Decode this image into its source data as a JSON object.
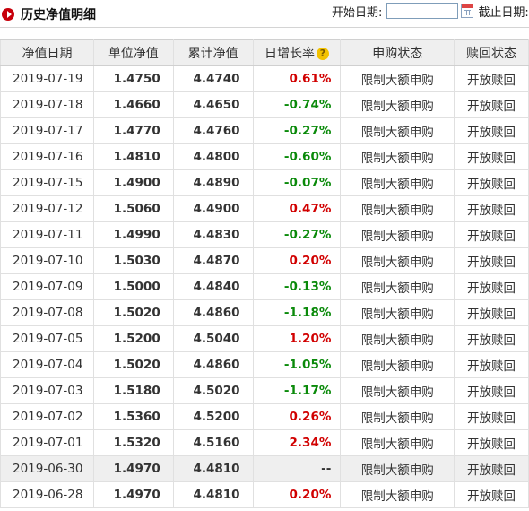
{
  "header": {
    "title": "历史净值明细",
    "start_label": "开始日期:",
    "start_value": "",
    "end_label": "截止日期:"
  },
  "colors": {
    "up": "#d10000",
    "down": "#0a8a0a",
    "brand": "#c7000b"
  },
  "columns": [
    "净值日期",
    "单位净值",
    "累计净值",
    "日增长率",
    "申购状态",
    "赎回状态"
  ],
  "help_icon": "?",
  "rows": [
    {
      "date": "2019-07-19",
      "unit": "1.4750",
      "acc": "4.4740",
      "chg": "0.61%",
      "dir": "up",
      "buy": "限制大额申购",
      "redeem": "开放赎回"
    },
    {
      "date": "2019-07-18",
      "unit": "1.4660",
      "acc": "4.4650",
      "chg": "-0.74%",
      "dir": "down",
      "buy": "限制大额申购",
      "redeem": "开放赎回"
    },
    {
      "date": "2019-07-17",
      "unit": "1.4770",
      "acc": "4.4760",
      "chg": "-0.27%",
      "dir": "down",
      "buy": "限制大额申购",
      "redeem": "开放赎回"
    },
    {
      "date": "2019-07-16",
      "unit": "1.4810",
      "acc": "4.4800",
      "chg": "-0.60%",
      "dir": "down",
      "buy": "限制大额申购",
      "redeem": "开放赎回"
    },
    {
      "date": "2019-07-15",
      "unit": "1.4900",
      "acc": "4.4890",
      "chg": "-0.07%",
      "dir": "down",
      "buy": "限制大额申购",
      "redeem": "开放赎回"
    },
    {
      "date": "2019-07-12",
      "unit": "1.5060",
      "acc": "4.4900",
      "chg": "0.47%",
      "dir": "up",
      "buy": "限制大额申购",
      "redeem": "开放赎回"
    },
    {
      "date": "2019-07-11",
      "unit": "1.4990",
      "acc": "4.4830",
      "chg": "-0.27%",
      "dir": "down",
      "buy": "限制大额申购",
      "redeem": "开放赎回"
    },
    {
      "date": "2019-07-10",
      "unit": "1.5030",
      "acc": "4.4870",
      "chg": "0.20%",
      "dir": "up",
      "buy": "限制大额申购",
      "redeem": "开放赎回"
    },
    {
      "date": "2019-07-09",
      "unit": "1.5000",
      "acc": "4.4840",
      "chg": "-0.13%",
      "dir": "down",
      "buy": "限制大额申购",
      "redeem": "开放赎回"
    },
    {
      "date": "2019-07-08",
      "unit": "1.5020",
      "acc": "4.4860",
      "chg": "-1.18%",
      "dir": "down",
      "buy": "限制大额申购",
      "redeem": "开放赎回"
    },
    {
      "date": "2019-07-05",
      "unit": "1.5200",
      "acc": "4.5040",
      "chg": "1.20%",
      "dir": "up",
      "buy": "限制大额申购",
      "redeem": "开放赎回"
    },
    {
      "date": "2019-07-04",
      "unit": "1.5020",
      "acc": "4.4860",
      "chg": "-1.05%",
      "dir": "down",
      "buy": "限制大额申购",
      "redeem": "开放赎回"
    },
    {
      "date": "2019-07-03",
      "unit": "1.5180",
      "acc": "4.5020",
      "chg": "-1.17%",
      "dir": "down",
      "buy": "限制大额申购",
      "redeem": "开放赎回"
    },
    {
      "date": "2019-07-02",
      "unit": "1.5360",
      "acc": "4.5200",
      "chg": "0.26%",
      "dir": "up",
      "buy": "限制大额申购",
      "redeem": "开放赎回"
    },
    {
      "date": "2019-07-01",
      "unit": "1.5320",
      "acc": "4.5160",
      "chg": "2.34%",
      "dir": "up",
      "buy": "限制大额申购",
      "redeem": "开放赎回"
    },
    {
      "date": "2019-06-30",
      "unit": "1.4970",
      "acc": "4.4810",
      "chg": "--",
      "dir": "flat",
      "buy": "限制大额申购",
      "redeem": "开放赎回",
      "highlight": true
    },
    {
      "date": "2019-06-28",
      "unit": "1.4970",
      "acc": "4.4810",
      "chg": "0.20%",
      "dir": "up",
      "buy": "限制大额申购",
      "redeem": "开放赎回"
    }
  ]
}
